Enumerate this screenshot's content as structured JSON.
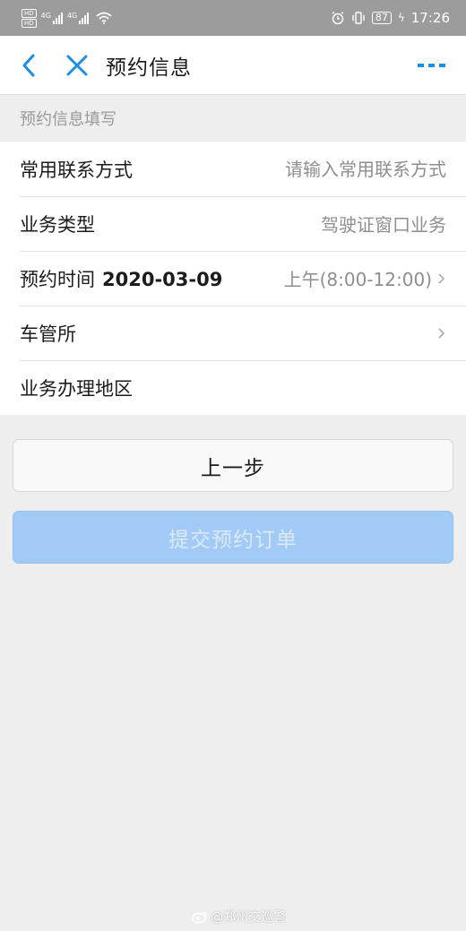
{
  "status_bar": {
    "hd1": "HD",
    "hd2": "HD",
    "net1": "4G",
    "net2": "4G",
    "battery": "87",
    "time": "17:26"
  },
  "nav": {
    "title": "预约信息",
    "back_icon": "chevron-left-icon",
    "close_icon": "close-icon",
    "more_icon": "more-icon",
    "accent": "#1a8fe6"
  },
  "form": {
    "section_title": "预约信息填写",
    "contact": {
      "label": "常用联系方式",
      "placeholder": "请输入常用联系方式",
      "value": ""
    },
    "business_type": {
      "label": "业务类型",
      "value": "驾驶证窗口业务"
    },
    "appointment_time": {
      "label": "预约时间",
      "date": "2020-03-09",
      "slot": "上午(8:00-12:00)"
    },
    "vehicle_office": {
      "label": "车管所",
      "value": ""
    },
    "region": {
      "label": "业务办理地区",
      "value": ""
    }
  },
  "buttons": {
    "prev": "上一步",
    "submit": "提交预约订单",
    "submit_color": "#a1cbf6"
  },
  "watermark": {
    "text": "@郑州交巡警"
  }
}
